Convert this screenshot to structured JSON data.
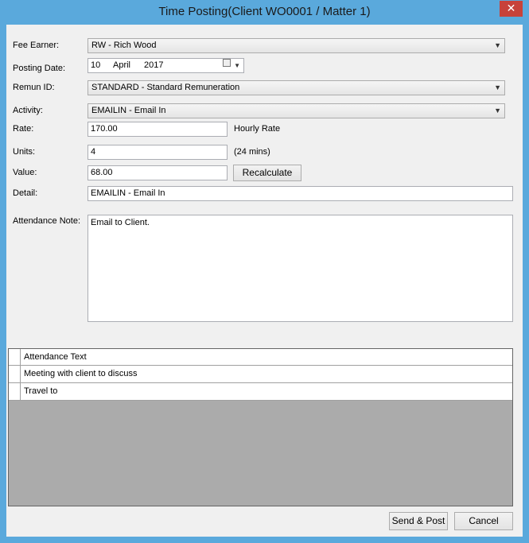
{
  "window": {
    "title": "Time Posting(Client WO0001 / Matter 1)",
    "close_glyph": "✕"
  },
  "form": {
    "fee_earner": {
      "label": "Fee Earner:",
      "value": "RW - Rich Wood"
    },
    "posting_date": {
      "label": "Posting Date:",
      "day": "10",
      "month": "April",
      "year": "2017"
    },
    "remun_id": {
      "label": "Remun ID:",
      "value": "STANDARD - Standard Remuneration"
    },
    "activity": {
      "label": "Activity:",
      "value": "EMAILIN - Email In"
    },
    "rate": {
      "label": "Rate:",
      "value": "170.00",
      "suffix": "Hourly Rate"
    },
    "units": {
      "label": "Units:",
      "value": "4",
      "suffix": "(24 mins)"
    },
    "value": {
      "label": "Value:",
      "value": "68.00",
      "recalculate_label": "Recalculate"
    },
    "detail": {
      "label": "Detail:",
      "value": "EMAILIN - Email In"
    },
    "attendance_note": {
      "label": "Attendance Note:",
      "value": "Email to Client."
    }
  },
  "grid": {
    "header": "Attendance Text",
    "rows": [
      "Meeting with client to discuss",
      "Travel to"
    ]
  },
  "footer": {
    "send_post_label": "Send & Post",
    "cancel_label": "Cancel"
  },
  "colors": {
    "titlebar": "#5aa9dc",
    "close": "#c7423a",
    "dialog_bg": "#f0f0f0",
    "grid_empty": "#ababab"
  },
  "icons": {
    "dropdown": "chevron-down-icon",
    "calendar": "calendar-icon",
    "close": "close-icon"
  }
}
